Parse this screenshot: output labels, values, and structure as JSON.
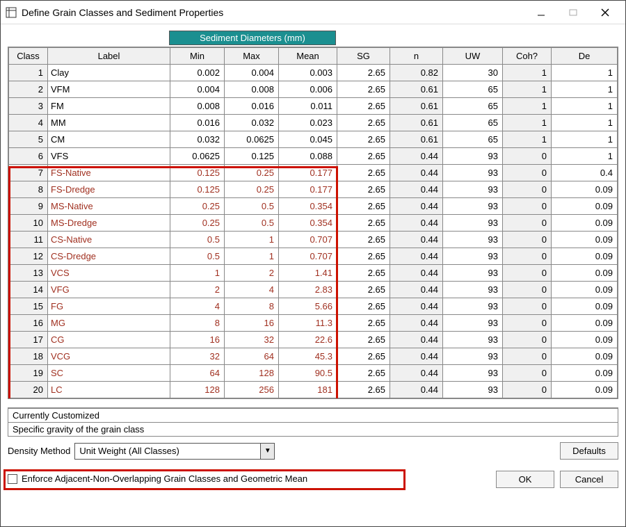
{
  "window": {
    "title": "Define Grain Classes and Sediment Properties"
  },
  "header": {
    "sediment_diameters": "Sediment Diameters (mm)"
  },
  "columns": {
    "class": "Class",
    "label": "Label",
    "min": "Min",
    "max": "Max",
    "mean": "Mean",
    "sg": "SG",
    "n": "n",
    "uw": "UW",
    "coh": "Coh?",
    "de": "De"
  },
  "rows": [
    {
      "class": "1",
      "label": "Clay",
      "min": "0.002",
      "max": "0.004",
      "mean": "0.003",
      "sg": "2.65",
      "n": "0.82",
      "uw": "30",
      "coh": "1",
      "de": "1",
      "group": false
    },
    {
      "class": "2",
      "label": "VFM",
      "min": "0.004",
      "max": "0.008",
      "mean": "0.006",
      "sg": "2.65",
      "n": "0.61",
      "uw": "65",
      "coh": "1",
      "de": "1",
      "group": false
    },
    {
      "class": "3",
      "label": "FM",
      "min": "0.008",
      "max": "0.016",
      "mean": "0.011",
      "sg": "2.65",
      "n": "0.61",
      "uw": "65",
      "coh": "1",
      "de": "1",
      "group": false
    },
    {
      "class": "4",
      "label": "MM",
      "min": "0.016",
      "max": "0.032",
      "mean": "0.023",
      "sg": "2.65",
      "n": "0.61",
      "uw": "65",
      "coh": "1",
      "de": "1",
      "group": false
    },
    {
      "class": "5",
      "label": "CM",
      "min": "0.032",
      "max": "0.0625",
      "mean": "0.045",
      "sg": "2.65",
      "n": "0.61",
      "uw": "65",
      "coh": "1",
      "de": "1",
      "group": false
    },
    {
      "class": "6",
      "label": "VFS",
      "min": "0.0625",
      "max": "0.125",
      "mean": "0.088",
      "sg": "2.65",
      "n": "0.44",
      "uw": "93",
      "coh": "0",
      "de": "1",
      "group": false
    },
    {
      "class": "7",
      "label": "FS-Native",
      "min": "0.125",
      "max": "0.25",
      "mean": "0.177",
      "sg": "2.65",
      "n": "0.44",
      "uw": "93",
      "coh": "0",
      "de": "0.4",
      "group": true
    },
    {
      "class": "8",
      "label": "FS-Dredge",
      "min": "0.125",
      "max": "0.25",
      "mean": "0.177",
      "sg": "2.65",
      "n": "0.44",
      "uw": "93",
      "coh": "0",
      "de": "0.09",
      "group": true
    },
    {
      "class": "9",
      "label": "MS-Native",
      "min": "0.25",
      "max": "0.5",
      "mean": "0.354",
      "sg": "2.65",
      "n": "0.44",
      "uw": "93",
      "coh": "0",
      "de": "0.09",
      "group": true
    },
    {
      "class": "10",
      "label": "MS-Dredge",
      "min": "0.25",
      "max": "0.5",
      "mean": "0.354",
      "sg": "2.65",
      "n": "0.44",
      "uw": "93",
      "coh": "0",
      "de": "0.09",
      "group": true
    },
    {
      "class": "11",
      "label": "CS-Native",
      "min": "0.5",
      "max": "1",
      "mean": "0.707",
      "sg": "2.65",
      "n": "0.44",
      "uw": "93",
      "coh": "0",
      "de": "0.09",
      "group": true
    },
    {
      "class": "12",
      "label": "CS-Dredge",
      "min": "0.5",
      "max": "1",
      "mean": "0.707",
      "sg": "2.65",
      "n": "0.44",
      "uw": "93",
      "coh": "0",
      "de": "0.09",
      "group": true
    },
    {
      "class": "13",
      "label": "VCS",
      "min": "1",
      "max": "2",
      "mean": "1.41",
      "sg": "2.65",
      "n": "0.44",
      "uw": "93",
      "coh": "0",
      "de": "0.09",
      "group": true
    },
    {
      "class": "14",
      "label": "VFG",
      "min": "2",
      "max": "4",
      "mean": "2.83",
      "sg": "2.65",
      "n": "0.44",
      "uw": "93",
      "coh": "0",
      "de": "0.09",
      "group": true
    },
    {
      "class": "15",
      "label": "FG",
      "min": "4",
      "max": "8",
      "mean": "5.66",
      "sg": "2.65",
      "n": "0.44",
      "uw": "93",
      "coh": "0",
      "de": "0.09",
      "group": true
    },
    {
      "class": "16",
      "label": "MG",
      "min": "8",
      "max": "16",
      "mean": "11.3",
      "sg": "2.65",
      "n": "0.44",
      "uw": "93",
      "coh": "0",
      "de": "0.09",
      "group": true
    },
    {
      "class": "17",
      "label": "CG",
      "min": "16",
      "max": "32",
      "mean": "22.6",
      "sg": "2.65",
      "n": "0.44",
      "uw": "93",
      "coh": "0",
      "de": "0.09",
      "group": true
    },
    {
      "class": "18",
      "label": "VCG",
      "min": "32",
      "max": "64",
      "mean": "45.3",
      "sg": "2.65",
      "n": "0.44",
      "uw": "93",
      "coh": "0",
      "de": "0.09",
      "group": true
    },
    {
      "class": "19",
      "label": "SC",
      "min": "64",
      "max": "128",
      "mean": "90.5",
      "sg": "2.65",
      "n": "0.44",
      "uw": "93",
      "coh": "0",
      "de": "0.09",
      "group": true
    },
    {
      "class": "20",
      "label": "LC",
      "min": "128",
      "max": "256",
      "mean": "181",
      "sg": "2.65",
      "n": "0.44",
      "uw": "93",
      "coh": "0",
      "de": "0.09",
      "group": true
    }
  ],
  "status": {
    "customized": "Currently Customized",
    "sg_desc": "Specific gravity of the grain class"
  },
  "density": {
    "label": "Density Method",
    "value": "Unit Weight (All Classes)"
  },
  "checkbox": {
    "label": "Enforce Adjacent-Non-Overlapping Grain Classes and Geometric Mean"
  },
  "buttons": {
    "defaults": "Defaults",
    "ok": "OK",
    "cancel": "Cancel"
  }
}
